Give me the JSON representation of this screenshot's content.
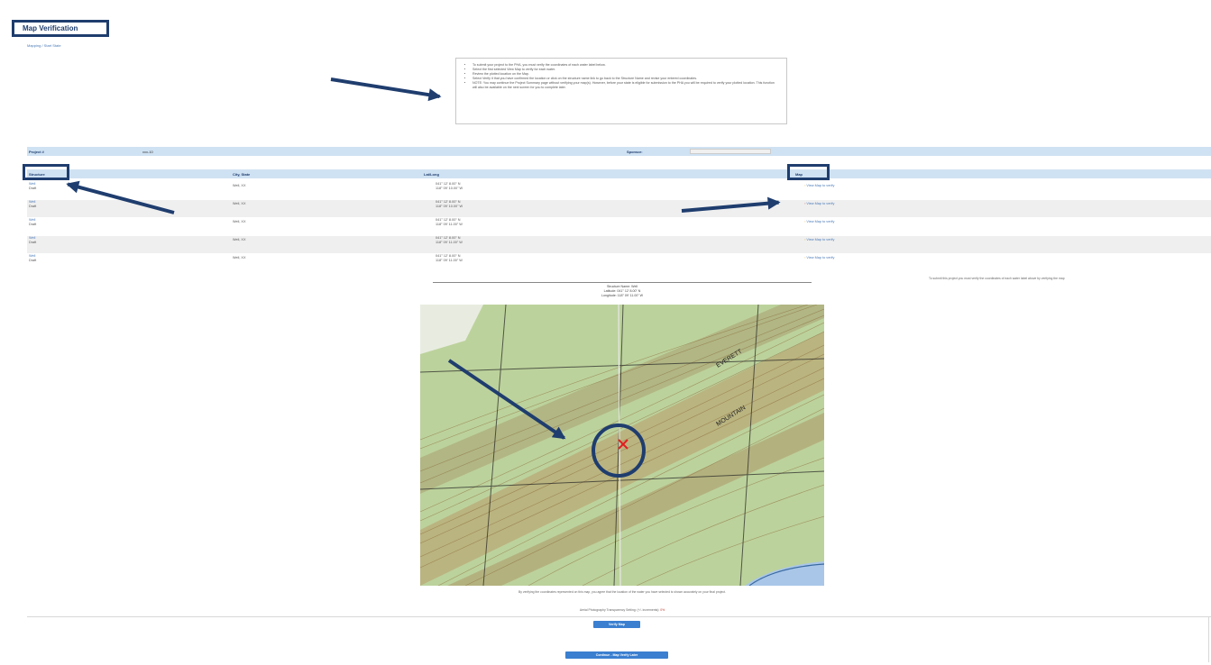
{
  "page": {
    "title": "Map Verification",
    "breadcrumb": "Mapping / Start State"
  },
  "instructions": [
    "To submit your project to the PHA, you must verify the coordinates of each water label below.",
    "Select the first selected View Map to verify for each water.",
    "Review the plotted location on the Map.",
    "Select Verify it that you have confirmed the location or click on the structure name link to go back to the Structure Name and revise your entered coordinates.",
    "NOTE: You may continue the Project Summary page without verifying your map(s). However, before your state is eligible for submission to the PHA you will be required to verify your plotted location. This function will also be available on the next screen for you to complete later."
  ],
  "info_bar": {
    "project_label": "Project #",
    "project_value": "xxx-10",
    "sponsor_label": "Sponsor:"
  },
  "table": {
    "headers": [
      "Structure",
      "City, State",
      "Lat/Long",
      "Map"
    ],
    "rows": [
      {
        "name": "Well",
        "sub": "Draft",
        "city": "Well, XX",
        "lat": "041° 12' 8.00\" N",
        "long": "118° 09' 10.00\" W",
        "map_link": "View Map to verify"
      },
      {
        "name": "Well",
        "sub": "Draft",
        "city": "Well, XX",
        "lat": "041° 12' 8.00\" N",
        "long": "118° 09' 10.00\" W",
        "map_link": "View Map to verify"
      },
      {
        "name": "Well",
        "sub": "Draft",
        "city": "Well, XX",
        "lat": "041° 12' 8.00\" N",
        "long": "118° 09' 11.00\" W",
        "map_link": "View Map to verify"
      },
      {
        "name": "Well",
        "sub": "Draft",
        "city": "Well, XX",
        "lat": "041° 12' 8.00\" N",
        "long": "118° 09' 11.00\" W",
        "map_link": "View Map to verify"
      },
      {
        "name": "Well",
        "sub": "Draft",
        "city": "Well, XX",
        "lat": "041° 12' 8.00\" N",
        "long": "118° 09' 11.00\" W",
        "map_link": "View Map to verify"
      }
    ]
  },
  "right_note": "To submit this project you must verify the coordinates of each water label above by verifying the map",
  "map": {
    "caption_name": "Structure Name: Well",
    "caption_lat": "Latitude: 041° 12' 8.00\" N",
    "caption_long": "Longitude: 118° 09' 11.00\" W",
    "map_label_a": "EVERETT",
    "map_label_b": "MOUNTAIN"
  },
  "disclaimer": "By verifying the coordinates represented on this map, you agree that the location of the water you have selected is shown accurately on your final project.",
  "transparency": {
    "label": "Aerial Photography Transparency Setting: (+/- increments):",
    "value": "0%"
  },
  "buttons": {
    "verify": "Verify Map",
    "continue": "Continue - Map Verify Later"
  },
  "colors": {
    "annotation": "#1f3d6e",
    "header_bg": "#cfe2f3",
    "button_bg": "#3a7fd0"
  }
}
